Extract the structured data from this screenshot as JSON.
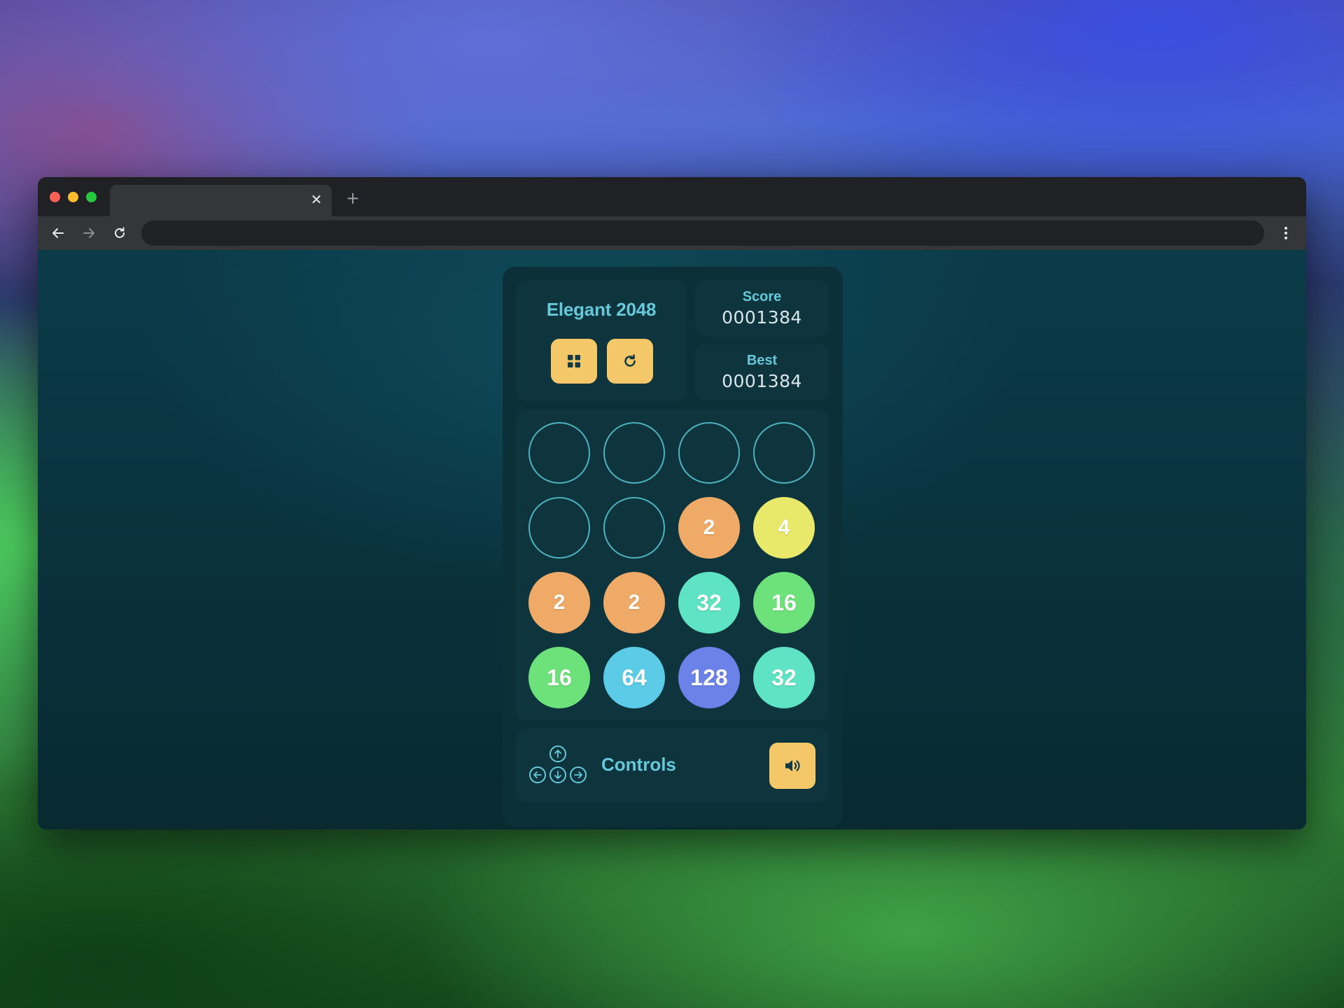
{
  "browser": {
    "tab_title": "",
    "tab_close_glyph": "✕",
    "new_tab_glyph": "+",
    "address": ""
  },
  "game": {
    "title": "Elegant 2048",
    "score_label": "Score",
    "score_value": "0001384",
    "best_label": "Best",
    "best_value": "0001384",
    "controls_label": "Controls",
    "board": [
      [
        null,
        null,
        null,
        null
      ],
      [
        null,
        null,
        2,
        4
      ],
      [
        2,
        2,
        32,
        16
      ],
      [
        16,
        64,
        128,
        32
      ]
    ],
    "tile_colors": {
      "2": "#eeaa66",
      "4": "#e8e86a",
      "16": "#6ee27a",
      "32": "#5ee4c4",
      "64": "#5ccbe8",
      "128": "#6b83e8"
    }
  },
  "colors": {
    "accent_text": "#66c8d8",
    "button_bg": "#f4c868",
    "empty_ring": "#4fb3bf"
  },
  "icons": {
    "grid_button": "grid-icon",
    "restart_button": "restart-icon",
    "sound_button": "speaker-icon"
  }
}
